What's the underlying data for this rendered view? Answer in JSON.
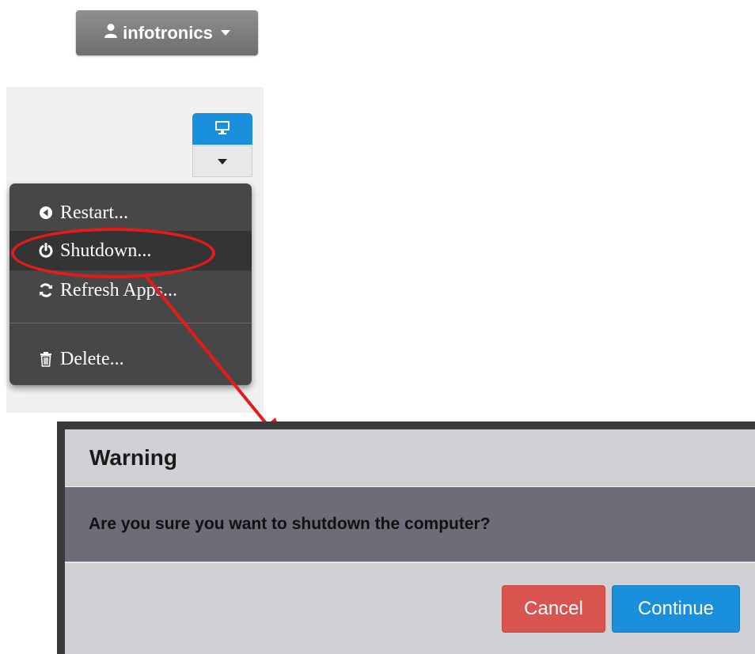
{
  "header": {
    "user_name": "infotronics",
    "user_icon": "user-icon",
    "caret_icon": "caret-down-icon"
  },
  "device_actions": {
    "monitor_icon": "monitor-icon",
    "dropdown_icon": "caret-down-icon"
  },
  "menu": {
    "items": [
      {
        "label": "Restart...",
        "icon": "restart-icon"
      },
      {
        "label": "Shutdown...",
        "icon": "power-icon"
      },
      {
        "label": "Refresh Apps...",
        "icon": "refresh-icon"
      },
      {
        "label": "Delete...",
        "icon": "trash-icon"
      }
    ]
  },
  "annotation": {
    "highlight_color": "#e31b1b"
  },
  "dialog": {
    "title": "Warning",
    "message": "Are you sure you want to shutdown the computer?",
    "cancel_label": "Cancel",
    "continue_label": "Continue"
  },
  "colors": {
    "primary": "#1a8fdc",
    "danger": "#d9534f",
    "menu_bg": "#474747"
  }
}
